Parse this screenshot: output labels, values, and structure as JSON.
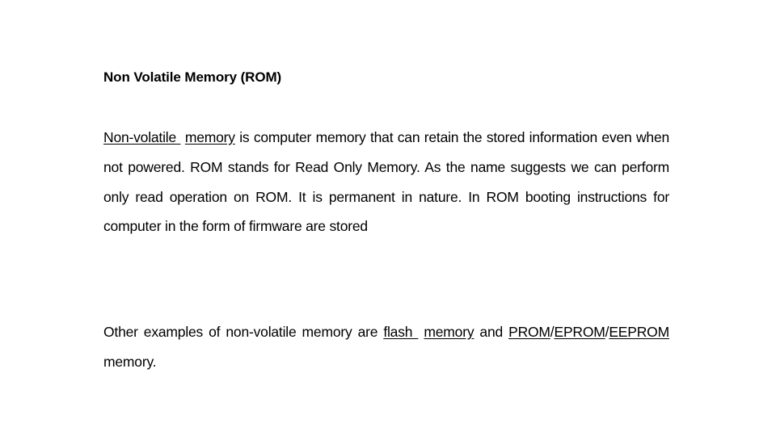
{
  "slide": {
    "title": "Non Volatile Memory (ROM)",
    "paragraph1": {
      "link_nonvolatile": "Non-volatile ",
      "link_memory": "memory",
      "text": " is computer memory that can retain the stored information even when not powered. ROM stands for Read Only Memory. As the name suggests we can perform only read operation on ROM. It is permanent in nature. In ROM booting instructions for computer in the form of firmware are stored"
    },
    "paragraph2": {
      "text_before": "Other examples of non-volatile memory are ",
      "link_flash": "flash ",
      "link_flash_memory": "memory",
      "text_and": " and ",
      "link_prom": "PROM",
      "sep1": "/",
      "link_eprom": "EPROM",
      "sep2": "/",
      "link_eeprom": "EEPROM",
      "text_after": " memory."
    }
  }
}
